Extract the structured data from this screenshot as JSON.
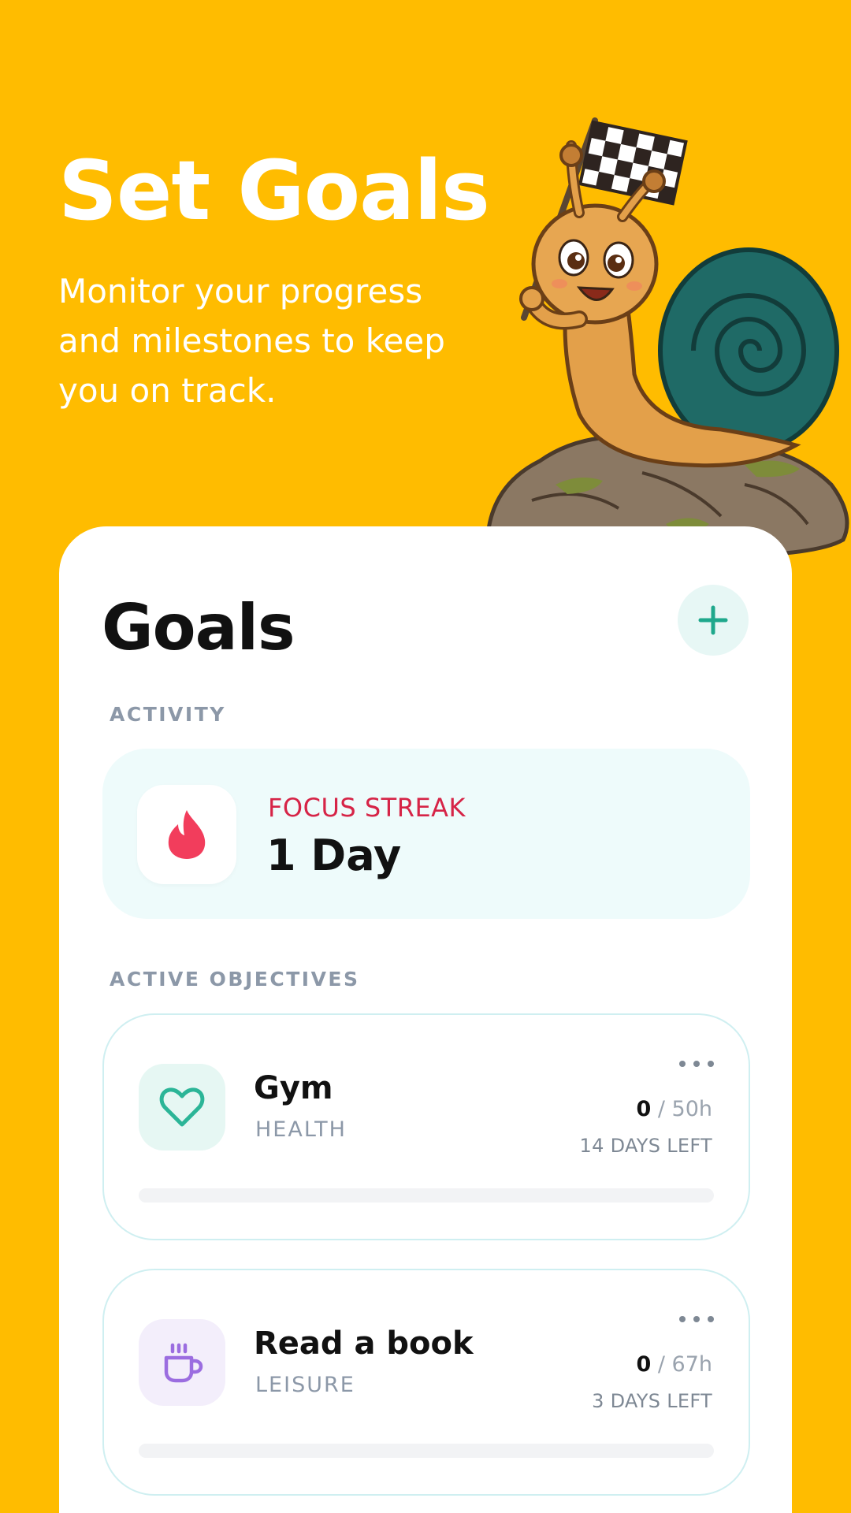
{
  "hero": {
    "title": "Set Goals",
    "subtitle": "Monitor your progress and milestones to keep you on track."
  },
  "goals_page": {
    "title": "Goals",
    "add_icon": "plus-icon",
    "accent_color": "#2BB597"
  },
  "activity": {
    "section_label": "ACTIVITY",
    "streak_label": "FOCUS STREAK",
    "streak_value": "1 Day",
    "streak_icon": "flame-icon",
    "streak_color": "#F23D5C"
  },
  "objectives": {
    "section_label": "ACTIVE OBJECTIVES",
    "items": [
      {
        "name": "Gym",
        "category": "HEALTH",
        "current": "0",
        "target": " / 50h",
        "days_left": "14 DAYS LEFT",
        "icon": "heart-icon",
        "icon_color": "#2BB597",
        "icon_bg": "#E6F7F3",
        "progress": 0
      },
      {
        "name": "Read a book",
        "category": "LEISURE",
        "current": "0",
        "target": " / 67h",
        "days_left": "3 DAYS LEFT",
        "icon": "coffee-cup-icon",
        "icon_color": "#9B6DE0",
        "icon_bg": "#F3EEFB",
        "progress": 0
      }
    ]
  }
}
